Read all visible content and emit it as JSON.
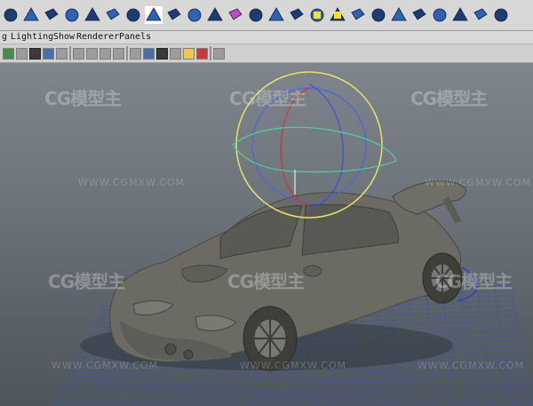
{
  "menubar": {
    "items": [
      "g",
      "Lighting",
      "Show",
      "Renderer",
      "Panels"
    ]
  },
  "shelf": {
    "icons": [
      "cylinder-icon",
      "cone-icon",
      "plane-icon",
      "torus-icon",
      "pyramid-icon",
      "nurbs-cylinder-icon",
      "sphere-icon",
      "bevel-icon",
      "extrude-icon",
      "globe-icon",
      "subdiv-icon",
      "cube-icon",
      "smooth-icon",
      "combine-icon",
      "separate-icon",
      "wedge-icon",
      "grid-icon",
      "append-icon",
      "merge-icon",
      "split-icon",
      "bridge-icon",
      "sculpt-icon",
      "mirror-icon",
      "extract-icon",
      "fill-hole-icon"
    ],
    "accent_colors": {
      "blue": "#2f62b5",
      "dark": "#1f3c72",
      "highlight": "#ffdd33",
      "magenta": "#c04ac7"
    }
  },
  "toolbar": {
    "icons": [
      "camera-icon",
      "bookmark-icon",
      "film-gate-icon",
      "resolution-gate-icon",
      "safe-action-icon",
      "grid-toggle-icon",
      "wireframe-icon",
      "smooth-shade-icon",
      "texture-icon",
      "lights-icon",
      "shadows-icon",
      "xray-icon",
      "isolate-icon",
      "render-icon",
      "ipr-icon",
      "snapshot-icon",
      "frame-all-icon",
      "frame-selected-icon",
      "hud-icon"
    ]
  },
  "viewport": {
    "watermarks": {
      "logo": "CG模型主",
      "url": "WWW.CGMXW.COM"
    },
    "colors": {
      "grid": "#3f5a9a",
      "car_body": "#6b6b64",
      "manipulator_yellow": "#e6e36a",
      "manipulator_blue": "#3a50d8",
      "manipulator_red": "#cc3232",
      "manipulator_green": "#4fd39a"
    }
  }
}
